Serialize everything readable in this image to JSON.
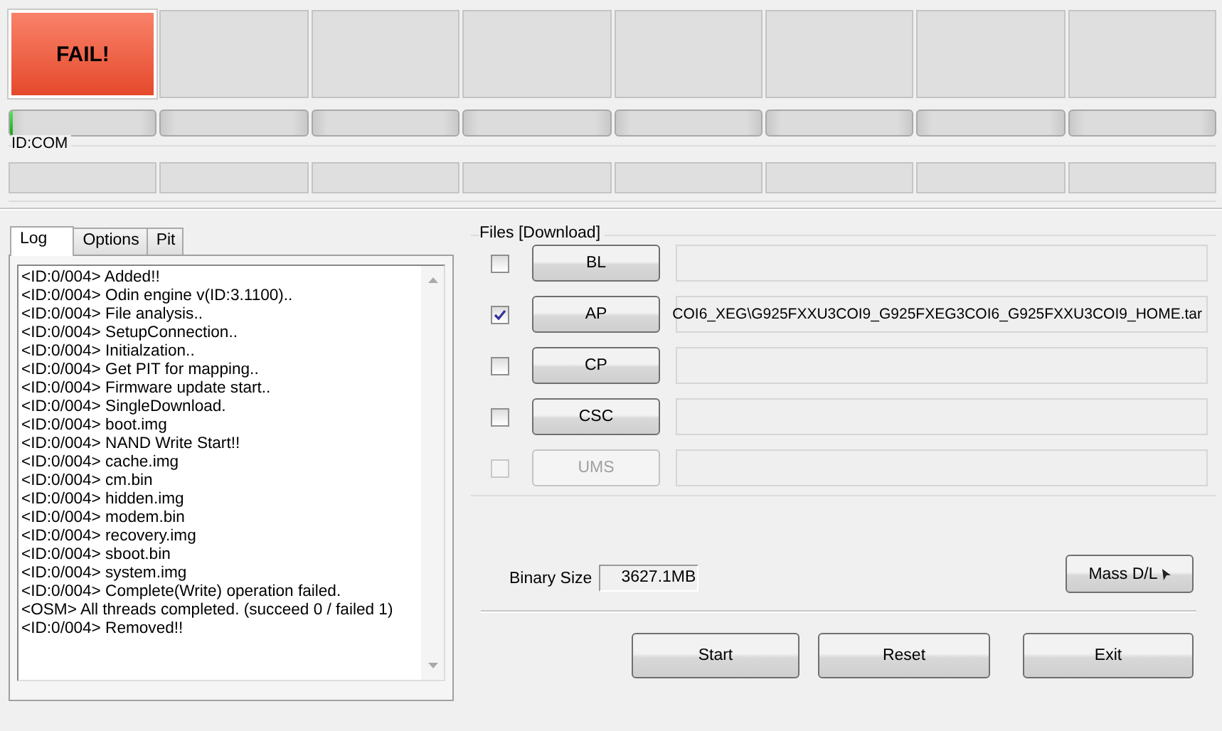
{
  "slots": [
    {
      "status": "FAIL!",
      "kind": "fail",
      "level": 0.02
    },
    {
      "kind": "idle",
      "level": 0
    },
    {
      "kind": "idle",
      "level": 0
    },
    {
      "kind": "idle",
      "level": 0
    },
    {
      "kind": "idle",
      "level": 0
    },
    {
      "kind": "idle",
      "level": 0
    },
    {
      "kind": "idle",
      "level": 0
    },
    {
      "kind": "idle",
      "level": 0
    }
  ],
  "id_com": {
    "label": "ID:COM"
  },
  "tabs": [
    {
      "label": "Log",
      "selected": true
    },
    {
      "label": "Options",
      "selected": false
    },
    {
      "label": "Pit",
      "selected": false
    }
  ],
  "log": [
    "<ID:0/004> Added!!",
    "<ID:0/004> Odin engine v(ID:3.1100)..",
    "<ID:0/004> File analysis..",
    "<ID:0/004> SetupConnection..",
    "<ID:0/004> Initialzation..",
    "<ID:0/004> Get PIT for mapping..",
    "<ID:0/004> Firmware update start..",
    "<ID:0/004> SingleDownload.",
    "<ID:0/004> boot.img",
    "<ID:0/004> NAND Write Start!!",
    "<ID:0/004> cache.img",
    "<ID:0/004> cm.bin",
    "<ID:0/004> hidden.img",
    "<ID:0/004> modem.bin",
    "<ID:0/004> recovery.img",
    "<ID:0/004> sboot.bin",
    "<ID:0/004> system.img",
    "<ID:0/004> Complete(Write) operation failed.",
    "<OSM> All threads completed. (succeed 0 / failed 1)",
    "<ID:0/004> Removed!!"
  ],
  "files": {
    "title": "Files [Download]",
    "rows": [
      {
        "label": "BL",
        "checked": false,
        "disabled": false
      },
      {
        "label": "AP",
        "checked": true,
        "disabled": false,
        "value": "COI6_XEG\\G925FXXU3COI9_G925FXEG3COI6_G925FXXU3COI9_HOME.tar"
      },
      {
        "label": "CP",
        "checked": false,
        "disabled": false
      },
      {
        "label": "CSC",
        "checked": false,
        "disabled": false
      },
      {
        "label": "UMS",
        "checked": false,
        "disabled": true
      }
    ]
  },
  "binary_size": {
    "label": "Binary Size",
    "value": "3627.1MB"
  },
  "mass_dl": {
    "label": "Mass D/L"
  },
  "buttons": [
    "Start",
    "Reset",
    "Exit"
  ]
}
